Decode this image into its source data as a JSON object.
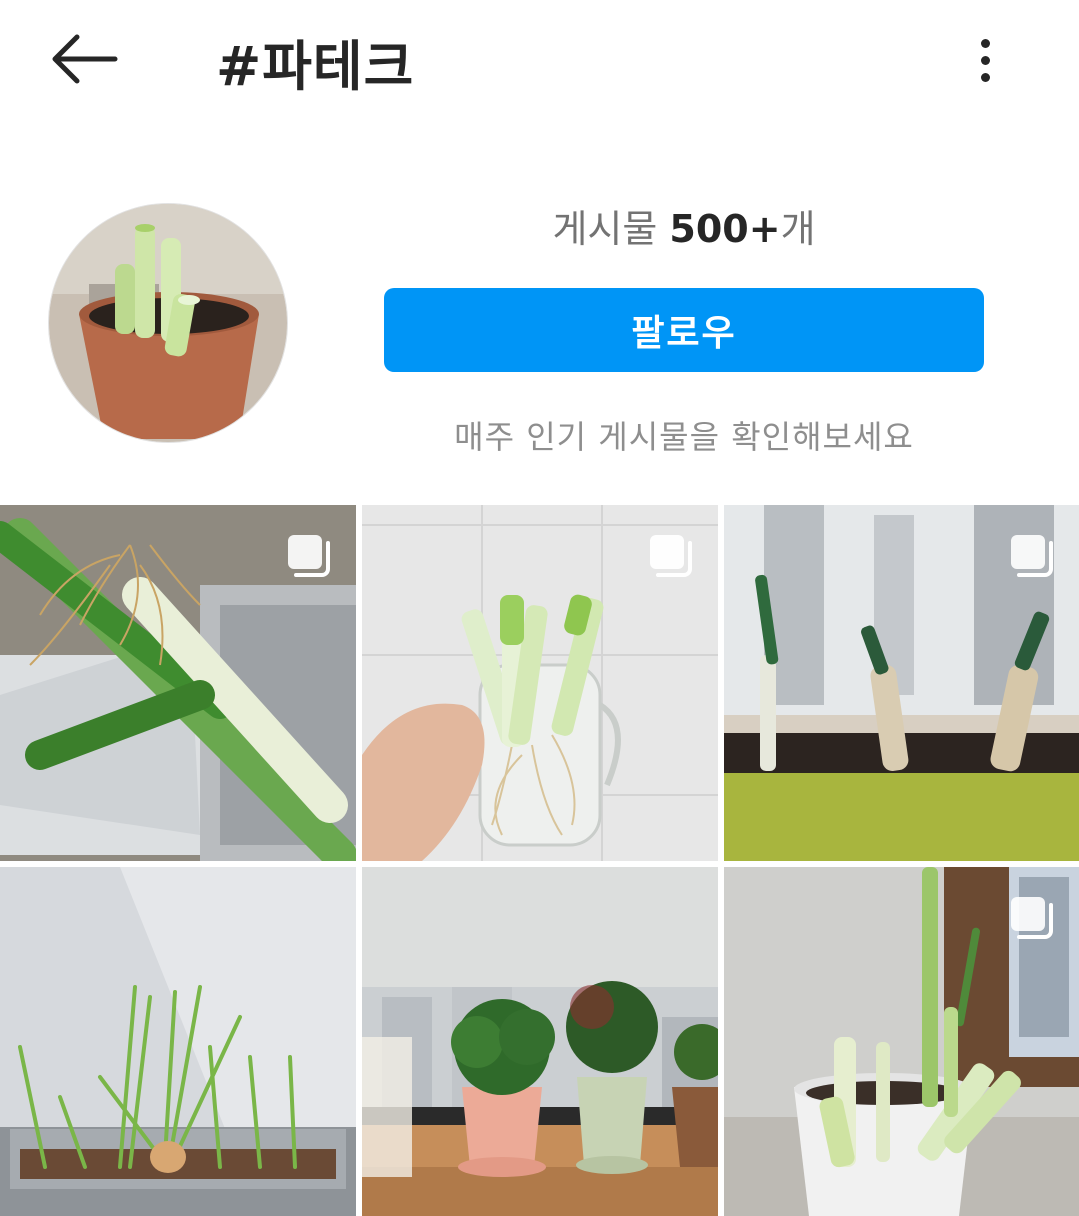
{
  "header": {
    "title": "#파테크",
    "back_icon": "arrow-left-icon",
    "more_icon": "more-vertical-icon"
  },
  "profile": {
    "posts_label": "게시물",
    "posts_count": "500+",
    "posts_suffix": "개",
    "follow_label": "팔로우",
    "weekly_text": "매주 인기 게시물을 확인해보세요"
  },
  "colors": {
    "accent": "#0095f6",
    "text": "#262626",
    "muted": "#8e8e8e"
  },
  "grid": {
    "posts": [
      {
        "subject": "leeks with roots in dish rack",
        "multi_icon": "carousel-icon"
      },
      {
        "subject": "leeks in glass mug held by hand",
        "multi_icon": "carousel-icon"
      },
      {
        "subject": "three leeks in green planter by window",
        "multi_icon": "carousel-icon"
      },
      {
        "subject": "green onions sprouting in grey planter",
        "multi_icon": ""
      },
      {
        "subject": "potted plants on window sill",
        "multi_icon": ""
      },
      {
        "subject": "leeks in white pot",
        "multi_icon": "carousel-icon"
      }
    ]
  }
}
